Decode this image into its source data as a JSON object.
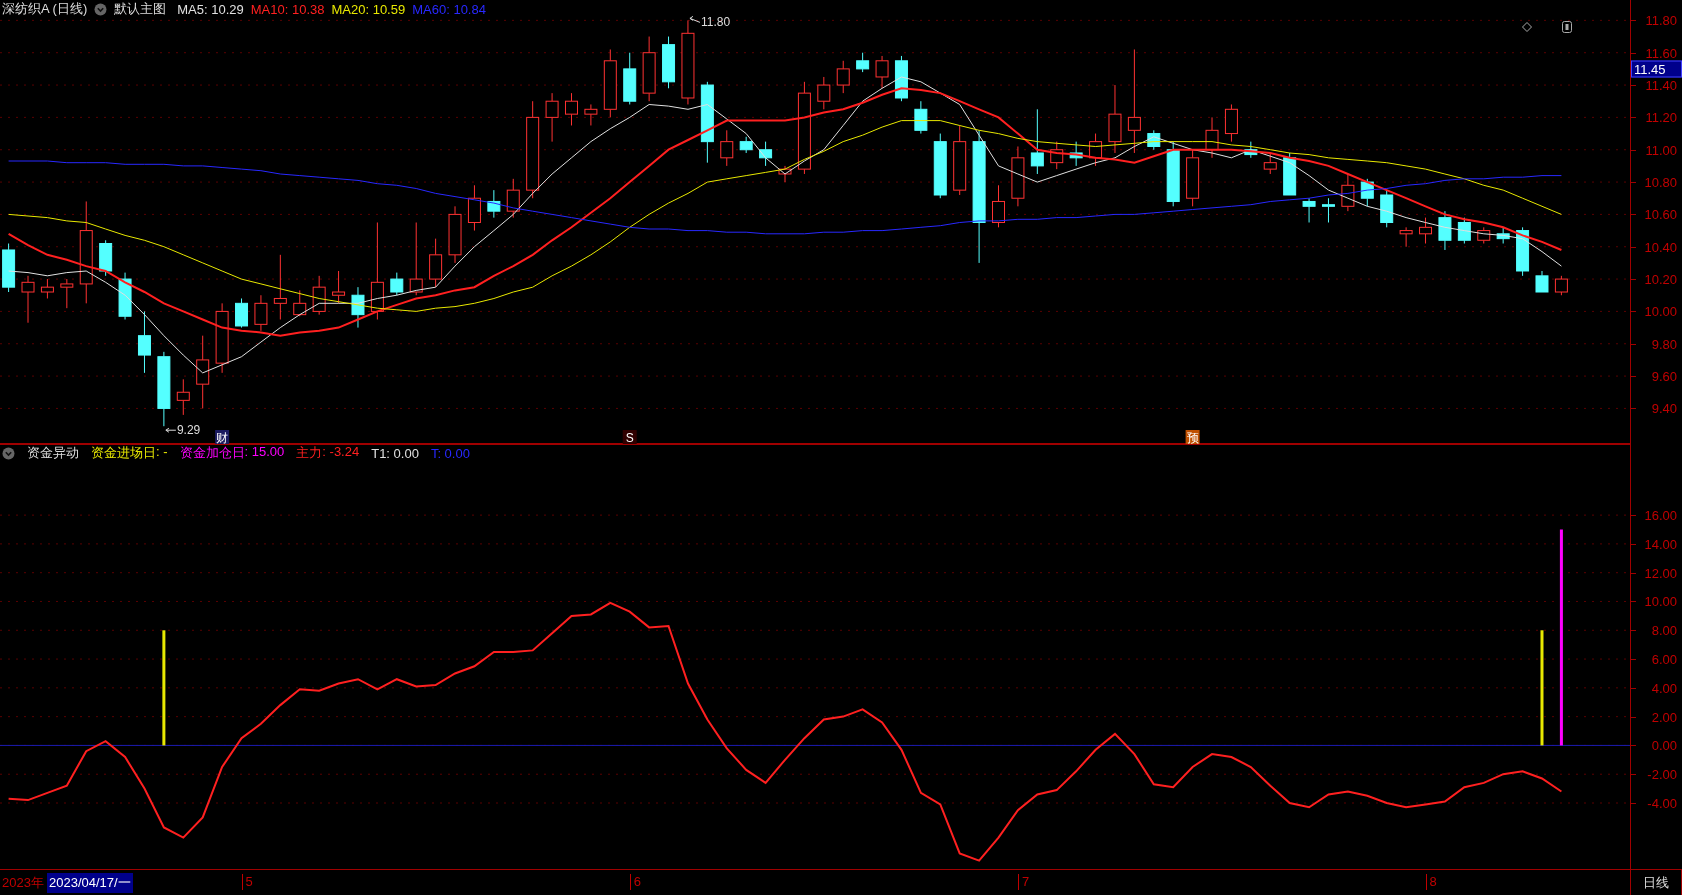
{
  "price_panel": {
    "title": "深纺织A (日线)",
    "template": "默认主图",
    "readings": [
      ": 10.29",
      ": 10.38",
      ": 10.59",
      ": 10.84"
    ],
    "price_marker": "11.45",
    "event_markers": [
      {
        "label": "财",
        "color": "#1a1a60"
      },
      {
        "label": "S",
        "color": "#300000"
      },
      {
        "label": "预",
        "color": "#c05000"
      }
    ],
    "chart_data": {
      "type": "candlestick",
      "ylim": [
        9.18,
        11.926
      ],
      "grid": true,
      "yticks": [
        {
          "value": 11.8,
          "label": "11.80"
        },
        {
          "value": 11.6,
          "label": "11.60"
        },
        {
          "value": 11.4,
          "label": "11.40"
        },
        {
          "value": 11.2,
          "label": "11.20"
        },
        {
          "value": 11.0,
          "label": "11.00"
        },
        {
          "value": 10.8,
          "label": "10.80"
        },
        {
          "value": 10.6,
          "label": "10.60"
        },
        {
          "value": 10.4,
          "label": "10.40"
        },
        {
          "value": 10.2,
          "label": "10.20"
        },
        {
          "value": 10.0,
          "label": "10.00"
        },
        {
          "value": 9.8,
          "label": "9.80"
        },
        {
          "value": 9.6,
          "label": "9.60"
        },
        {
          "value": 9.4,
          "label": "9.40"
        }
      ],
      "ohlc": [
        [
          10.38,
          10.42,
          10.12,
          10.15
        ],
        [
          10.12,
          10.22,
          9.93,
          10.18
        ],
        [
          10.12,
          10.2,
          10.08,
          10.15
        ],
        [
          10.15,
          10.2,
          10.02,
          10.17
        ],
        [
          10.17,
          10.68,
          10.05,
          10.5
        ],
        [
          10.42,
          10.44,
          10.22,
          10.25
        ],
        [
          10.2,
          10.24,
          9.95,
          9.97
        ],
        [
          9.85,
          10.0,
          9.62,
          9.73
        ],
        [
          9.72,
          9.75,
          9.29,
          9.4
        ],
        [
          9.45,
          9.58,
          9.36,
          9.5
        ],
        [
          9.55,
          9.85,
          9.4,
          9.7
        ],
        [
          9.68,
          10.05,
          9.62,
          10.0
        ],
        [
          10.05,
          10.08,
          9.9,
          9.91
        ],
        [
          9.92,
          10.1,
          9.88,
          10.05
        ],
        [
          10.05,
          10.35,
          9.95,
          10.08
        ],
        [
          9.98,
          10.13,
          9.97,
          10.05
        ],
        [
          10.0,
          10.22,
          9.98,
          10.15
        ],
        [
          10.1,
          10.25,
          10.05,
          10.12
        ],
        [
          10.1,
          10.15,
          9.9,
          9.98
        ],
        [
          10.0,
          10.55,
          9.95,
          10.18
        ],
        [
          10.2,
          10.24,
          10.1,
          10.12
        ],
        [
          10.12,
          10.55,
          10.1,
          10.2
        ],
        [
          10.2,
          10.45,
          10.15,
          10.35
        ],
        [
          10.35,
          10.65,
          10.3,
          10.6
        ],
        [
          10.55,
          10.78,
          10.5,
          10.7
        ],
        [
          10.68,
          10.75,
          10.58,
          10.62
        ],
        [
          10.62,
          10.82,
          10.58,
          10.75
        ],
        [
          10.75,
          11.3,
          10.7,
          11.2
        ],
        [
          11.2,
          11.35,
          11.05,
          11.3
        ],
        [
          11.22,
          11.35,
          11.15,
          11.3
        ],
        [
          11.22,
          11.28,
          11.15,
          11.25
        ],
        [
          11.25,
          11.62,
          11.2,
          11.55
        ],
        [
          11.5,
          11.6,
          11.28,
          11.3
        ],
        [
          11.35,
          11.7,
          11.3,
          11.6
        ],
        [
          11.65,
          11.7,
          11.38,
          11.42
        ],
        [
          11.32,
          11.8,
          11.28,
          11.72
        ],
        [
          11.4,
          11.42,
          10.92,
          11.05
        ],
        [
          10.95,
          11.12,
          10.9,
          11.05
        ],
        [
          11.05,
          11.08,
          10.98,
          11.0
        ],
        [
          11.0,
          11.05,
          10.9,
          10.95
        ],
        [
          10.85,
          10.9,
          10.8,
          10.88
        ],
        [
          10.88,
          11.42,
          10.85,
          11.35
        ],
        [
          11.3,
          11.45,
          11.25,
          11.4
        ],
        [
          11.4,
          11.55,
          11.35,
          11.5
        ],
        [
          11.55,
          11.6,
          11.48,
          11.5
        ],
        [
          11.45,
          11.58,
          11.38,
          11.55
        ],
        [
          11.55,
          11.58,
          11.3,
          11.32
        ],
        [
          11.25,
          11.3,
          11.1,
          11.12
        ],
        [
          11.05,
          11.1,
          10.7,
          10.72
        ],
        [
          10.75,
          11.15,
          10.72,
          11.05
        ],
        [
          11.05,
          11.12,
          10.3,
          10.55
        ],
        [
          10.55,
          10.78,
          10.52,
          10.68
        ],
        [
          10.7,
          11.02,
          10.65,
          10.95
        ],
        [
          10.98,
          11.25,
          10.85,
          10.9
        ],
        [
          10.92,
          11.05,
          10.88,
          11.0
        ],
        [
          10.98,
          11.05,
          10.9,
          10.95
        ],
        [
          10.95,
          11.1,
          10.9,
          11.05
        ],
        [
          11.05,
          11.4,
          10.98,
          11.22
        ],
        [
          11.12,
          11.62,
          10.98,
          11.2
        ],
        [
          11.1,
          11.12,
          11.0,
          11.02
        ],
        [
          11.0,
          11.05,
          10.65,
          10.68
        ],
        [
          10.7,
          11.0,
          10.65,
          10.95
        ],
        [
          11.0,
          11.2,
          10.95,
          11.12
        ],
        [
          11.1,
          11.28,
          11.05,
          11.25
        ],
        [
          11.0,
          11.05,
          10.95,
          10.97
        ],
        [
          10.88,
          10.98,
          10.85,
          10.92
        ],
        [
          10.95,
          10.98,
          10.72,
          10.72
        ],
        [
          10.68,
          10.7,
          10.55,
          10.65
        ],
        [
          10.66,
          10.7,
          10.55,
          10.65
        ],
        [
          10.65,
          10.85,
          10.62,
          10.78
        ],
        [
          10.8,
          10.82,
          10.65,
          10.7
        ],
        [
          10.72,
          10.75,
          10.52,
          10.55
        ],
        [
          10.48,
          10.52,
          10.4,
          10.5
        ],
        [
          10.48,
          10.58,
          10.42,
          10.52
        ],
        [
          10.58,
          10.62,
          10.38,
          10.44
        ],
        [
          10.55,
          10.58,
          10.42,
          10.44
        ],
        [
          10.44,
          10.52,
          10.42,
          10.5
        ],
        [
          10.48,
          10.52,
          10.42,
          10.45
        ],
        [
          10.5,
          10.52,
          10.22,
          10.25
        ],
        [
          10.22,
          10.25,
          10.12,
          10.12
        ],
        [
          10.12,
          10.22,
          10.1,
          10.2
        ]
      ],
      "series": [
        {
          "name": "MA5",
          "type": "line",
          "color": "#e0e0e0",
          "values": [
            10.25,
            10.24,
            10.22,
            10.24,
            10.25,
            10.18,
            10.1,
            9.98,
            9.85,
            9.73,
            9.62,
            9.67,
            9.72,
            9.81,
            9.9,
            9.98,
            10.05,
            10.05,
            10.05,
            10.08,
            10.1,
            10.13,
            10.15,
            10.28,
            10.4,
            10.5,
            10.6,
            10.73,
            10.85,
            10.95,
            11.05,
            11.13,
            11.2,
            11.28,
            11.27,
            11.25,
            11.28,
            11.19,
            11.1,
            10.95,
            10.85,
            10.93,
            11.0,
            11.15,
            11.3,
            11.38,
            11.45,
            11.42,
            11.35,
            11.28,
            11.09,
            10.9,
            10.85,
            10.8,
            10.84,
            10.88,
            10.92,
            10.95,
            11.02,
            11.08,
            11.04,
            11.0,
            10.98,
            10.95,
            11.0,
            10.96,
            10.92,
            10.84,
            10.75,
            10.7,
            10.65,
            10.62,
            10.58,
            10.55,
            10.52,
            10.5,
            10.48,
            10.47,
            10.45,
            10.37,
            10.28
          ]
        },
        {
          "name": "MA10",
          "type": "line",
          "color": "#ff2020",
          "values": [
            10.48,
            10.41,
            10.35,
            10.32,
            10.28,
            10.25,
            10.18,
            10.12,
            10.05,
            10.0,
            9.95,
            9.9,
            9.88,
            9.87,
            9.85,
            9.87,
            9.88,
            9.9,
            9.95,
            10.0,
            10.04,
            10.08,
            10.1,
            10.13,
            10.15,
            10.22,
            10.28,
            10.35,
            10.44,
            10.52,
            10.61,
            10.7,
            10.8,
            10.9,
            11.0,
            11.06,
            11.12,
            11.18,
            11.18,
            11.18,
            11.18,
            11.2,
            11.23,
            11.25,
            11.29,
            11.34,
            11.38,
            11.37,
            11.35,
            11.3,
            11.25,
            11.2,
            11.1,
            11.0,
            10.98,
            10.97,
            10.95,
            10.94,
            10.92,
            10.96,
            11.0,
            11.0,
            11.0,
            11.0,
            10.99,
            10.98,
            10.95,
            10.93,
            10.9,
            10.85,
            10.8,
            10.75,
            10.7,
            10.65,
            10.6,
            10.57,
            10.55,
            10.52,
            10.47,
            10.43,
            10.38
          ]
        },
        {
          "name": "MA20",
          "type": "line",
          "color": "#e8e800",
          "values": [
            10.6,
            10.59,
            10.58,
            10.56,
            10.55,
            10.51,
            10.47,
            10.44,
            10.4,
            10.35,
            10.3,
            10.25,
            10.2,
            10.17,
            10.14,
            10.11,
            10.08,
            10.06,
            10.04,
            10.02,
            10.01,
            10.0,
            10.02,
            10.03,
            10.05,
            10.08,
            10.12,
            10.15,
            10.22,
            10.28,
            10.35,
            10.43,
            10.52,
            10.6,
            10.67,
            10.73,
            10.8,
            10.82,
            10.84,
            10.86,
            10.88,
            10.94,
            10.99,
            11.05,
            11.09,
            11.14,
            11.18,
            11.18,
            11.18,
            11.15,
            11.12,
            11.1,
            11.07,
            11.05,
            11.04,
            11.03,
            11.02,
            11.03,
            11.04,
            11.05,
            11.05,
            11.05,
            11.05,
            11.03,
            11.02,
            11.0,
            10.98,
            10.97,
            10.95,
            10.94,
            10.93,
            10.92,
            10.9,
            10.88,
            10.85,
            10.82,
            10.78,
            10.75,
            10.7,
            10.65,
            10.6
          ]
        },
        {
          "name": "MA60",
          "type": "line",
          "color": "#2828ff",
          "values": [
            10.93,
            10.93,
            10.93,
            10.92,
            10.92,
            10.92,
            10.91,
            10.91,
            10.91,
            10.9,
            10.9,
            10.89,
            10.88,
            10.87,
            10.85,
            10.84,
            10.83,
            10.82,
            10.81,
            10.79,
            10.78,
            10.76,
            10.73,
            10.71,
            10.69,
            10.67,
            10.64,
            10.62,
            10.6,
            10.58,
            10.56,
            10.54,
            10.52,
            10.51,
            10.51,
            10.5,
            10.5,
            10.49,
            10.49,
            10.48,
            10.48,
            10.48,
            10.49,
            10.49,
            10.5,
            10.5,
            10.51,
            10.52,
            10.53,
            10.55,
            10.56,
            10.56,
            10.57,
            10.57,
            10.58,
            10.58,
            10.59,
            10.6,
            10.6,
            10.61,
            10.62,
            10.63,
            10.64,
            10.65,
            10.66,
            10.68,
            10.69,
            10.7,
            10.72,
            10.73,
            10.75,
            10.76,
            10.78,
            10.79,
            10.81,
            10.82,
            10.82,
            10.83,
            10.83,
            10.84,
            10.84
          ]
        }
      ],
      "annotations": [
        "11.80",
        "9.29"
      ]
    }
  },
  "indicator_panel": {
    "title": "资金异动",
    "readings": [
      ": -",
      ": 15.00",
      ": -3.24"
    ],
    "other_legend": [
      {
        "label": "T1: 0.00",
        "color": "#e0e0e0"
      },
      {
        "label": "T: 0.00",
        "color": "#2828ff"
      }
    ],
    "chart_data": {
      "type": "line",
      "ylim": [
        -10.39,
        20.94
      ],
      "grid": true,
      "ref_lines": [
        {
          "axis": "y",
          "value": 0
        }
      ],
      "yticks": [
        {
          "value": 16,
          "label": "16.00"
        },
        {
          "value": 14,
          "label": "14.00"
        },
        {
          "value": 12,
          "label": "12.00"
        },
        {
          "value": 10,
          "label": "10.00"
        },
        {
          "value": 8,
          "label": "8.00"
        },
        {
          "value": 6,
          "label": "6.00"
        },
        {
          "value": 4,
          "label": "4.00"
        },
        {
          "value": 2,
          "label": "2.00"
        },
        {
          "value": 0,
          "label": "0.00"
        },
        {
          "value": -2,
          "label": "-2.00"
        },
        {
          "value": -4,
          "label": "-4.00"
        }
      ],
      "series": [
        {
          "name": "资金进场日",
          "type": "bar",
          "color": "#e8e800",
          "values": [
            null,
            null,
            null,
            null,
            null,
            null,
            null,
            null,
            8,
            null,
            null,
            null,
            null,
            null,
            null,
            null,
            null,
            null,
            null,
            null,
            null,
            null,
            null,
            null,
            null,
            null,
            null,
            null,
            null,
            null,
            null,
            null,
            null,
            null,
            null,
            null,
            null,
            null,
            null,
            null,
            null,
            null,
            null,
            null,
            null,
            null,
            null,
            null,
            null,
            null,
            null,
            null,
            null,
            null,
            null,
            null,
            null,
            null,
            null,
            null,
            null,
            null,
            null,
            null,
            null,
            null,
            null,
            null,
            null,
            null,
            null,
            null,
            null,
            null,
            null,
            null,
            null,
            null,
            null,
            8,
            null
          ]
        },
        {
          "name": "资金加仓日",
          "type": "bar",
          "color": "#ff00ff",
          "values": [
            null,
            null,
            null,
            null,
            null,
            null,
            null,
            null,
            null,
            null,
            null,
            null,
            null,
            null,
            null,
            null,
            null,
            null,
            null,
            null,
            null,
            null,
            null,
            null,
            null,
            null,
            null,
            null,
            null,
            null,
            null,
            null,
            null,
            null,
            null,
            null,
            null,
            null,
            null,
            null,
            null,
            null,
            null,
            null,
            null,
            null,
            null,
            null,
            null,
            null,
            null,
            null,
            null,
            null,
            null,
            null,
            null,
            null,
            null,
            null,
            null,
            null,
            null,
            null,
            null,
            null,
            null,
            null,
            null,
            null,
            null,
            null,
            null,
            null,
            null,
            null,
            null,
            null,
            null,
            null,
            15
          ]
        },
        {
          "name": "主力",
          "type": "line",
          "color": "#ff2020",
          "values": [
            -3.7,
            -3.8,
            -3.3,
            -2.8,
            -0.4,
            0.3,
            -0.8,
            -3.0,
            -5.7,
            -6.4,
            -5.0,
            -1.5,
            0.5,
            1.5,
            2.8,
            3.9,
            3.8,
            4.3,
            4.6,
            3.9,
            4.6,
            4.1,
            4.2,
            5.0,
            5.5,
            6.5,
            6.5,
            6.6,
            7.8,
            9.0,
            9.1,
            9.9,
            9.3,
            8.2,
            8.3,
            4.3,
            1.8,
            -0.2,
            -1.7,
            -2.6,
            -1.0,
            0.5,
            1.8,
            2.0,
            2.5,
            1.6,
            -0.3,
            -3.3,
            -4.1,
            -7.5,
            -8.0,
            -6.4,
            -4.5,
            -3.4,
            -3.1,
            -1.8,
            -0.3,
            0.8,
            -0.6,
            -2.7,
            -2.9,
            -1.5,
            -0.6,
            -0.8,
            -1.5,
            -2.8,
            -4.0,
            -4.3,
            -3.4,
            -3.2,
            -3.5,
            -4.0,
            -4.3,
            -4.1,
            -3.9,
            -2.9,
            -2.6,
            -2.0,
            -1.8,
            -2.3,
            -3.2
          ]
        }
      ]
    }
  },
  "time_axis": {
    "year": "2023年",
    "cursor_date": "2023/04/17/一",
    "months": [
      "5",
      "6",
      "7",
      "8"
    ],
    "period": "日线"
  }
}
